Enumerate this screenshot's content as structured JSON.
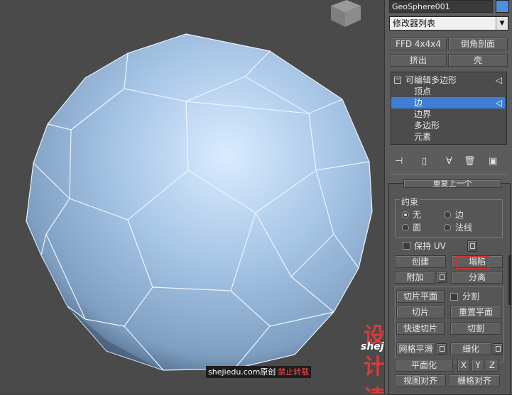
{
  "viewport": {
    "name": "perspective-viewport"
  },
  "panel": {
    "object_name": "GeoSphere001",
    "object_color": "#4f8fe0",
    "modifier_list": "修改器列表",
    "buttons": {
      "ffd": "FFD 4x4x4",
      "chamfer_profile": "倒角剖面",
      "extrude": "挤出",
      "shell": "壳"
    },
    "stack": {
      "root": "可编辑多边形",
      "items": [
        "顶点",
        "边",
        "边界",
        "多边形",
        "元素"
      ],
      "selected": "边"
    },
    "repeat_last": "重复上一个",
    "constraints": {
      "title": "约束",
      "options": [
        "无",
        "边",
        "面",
        "法线"
      ],
      "selected": "无"
    },
    "preserve_uv": "保持 UV",
    "ops": {
      "create": "创建",
      "collapse": "塌陷",
      "attach": "附加",
      "detach": "分离",
      "slice_plane": "切片平面",
      "split": "分割",
      "slice": "切片",
      "reset_plane": "重置平面",
      "quickslice": "快速切片",
      "cut": "切割",
      "meshsmooth": "网格平滑",
      "tessellate": "细化",
      "planarize": "平面化",
      "x": "X",
      "y": "Y",
      "z": "Z",
      "view_align": "视图对齐",
      "grid_align": "栅格对齐"
    }
  },
  "watermark": {
    "logo_text": "设计读",
    "site": "shejiedu.com",
    "credit_site": "shejiedu.com原创",
    "credit_warn": "禁止转载"
  }
}
